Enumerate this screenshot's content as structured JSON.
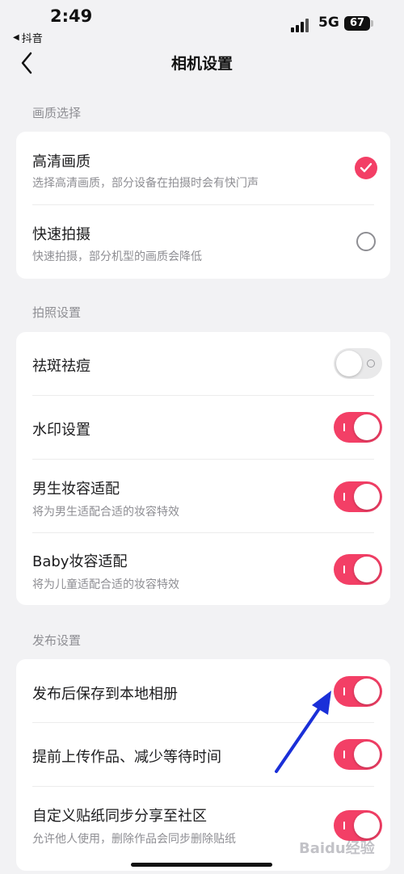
{
  "status_bar": {
    "time": "2:49",
    "back_app": "抖音",
    "network": "5G",
    "battery": "67"
  },
  "nav": {
    "title": "相机设置"
  },
  "sections": {
    "quality": {
      "label": "画质选择",
      "items": [
        {
          "title": "高清画质",
          "desc": "选择高清画质，部分设备在拍摄时会有快门声",
          "selected": true
        },
        {
          "title": "快速拍摄",
          "desc": "快速拍摄，部分机型的画质会降低",
          "selected": false
        }
      ]
    },
    "photo": {
      "label": "拍照设置",
      "items": [
        {
          "title": "祛斑祛痘",
          "on": false
        },
        {
          "title": "水印设置",
          "on": true
        },
        {
          "title": "男生妆容适配",
          "desc": "将为男生适配合适的妆容特效",
          "on": true
        },
        {
          "title": "Baby妆容适配",
          "desc": "将为儿童适配合适的妆容特效",
          "on": true
        }
      ]
    },
    "publish": {
      "label": "发布设置",
      "items": [
        {
          "title": "发布后保存到本地相册",
          "on": true
        },
        {
          "title": "提前上传作品、减少等待时间",
          "on": true
        },
        {
          "title": "自定义贴纸同步分享至社区",
          "desc": "允许他人使用，删除作品会同步删除贴纸",
          "on": true
        }
      ]
    }
  },
  "colors": {
    "accent": "#f33f66",
    "annotation_arrow": "#1a2fd8"
  },
  "watermark": "Baidu经验"
}
